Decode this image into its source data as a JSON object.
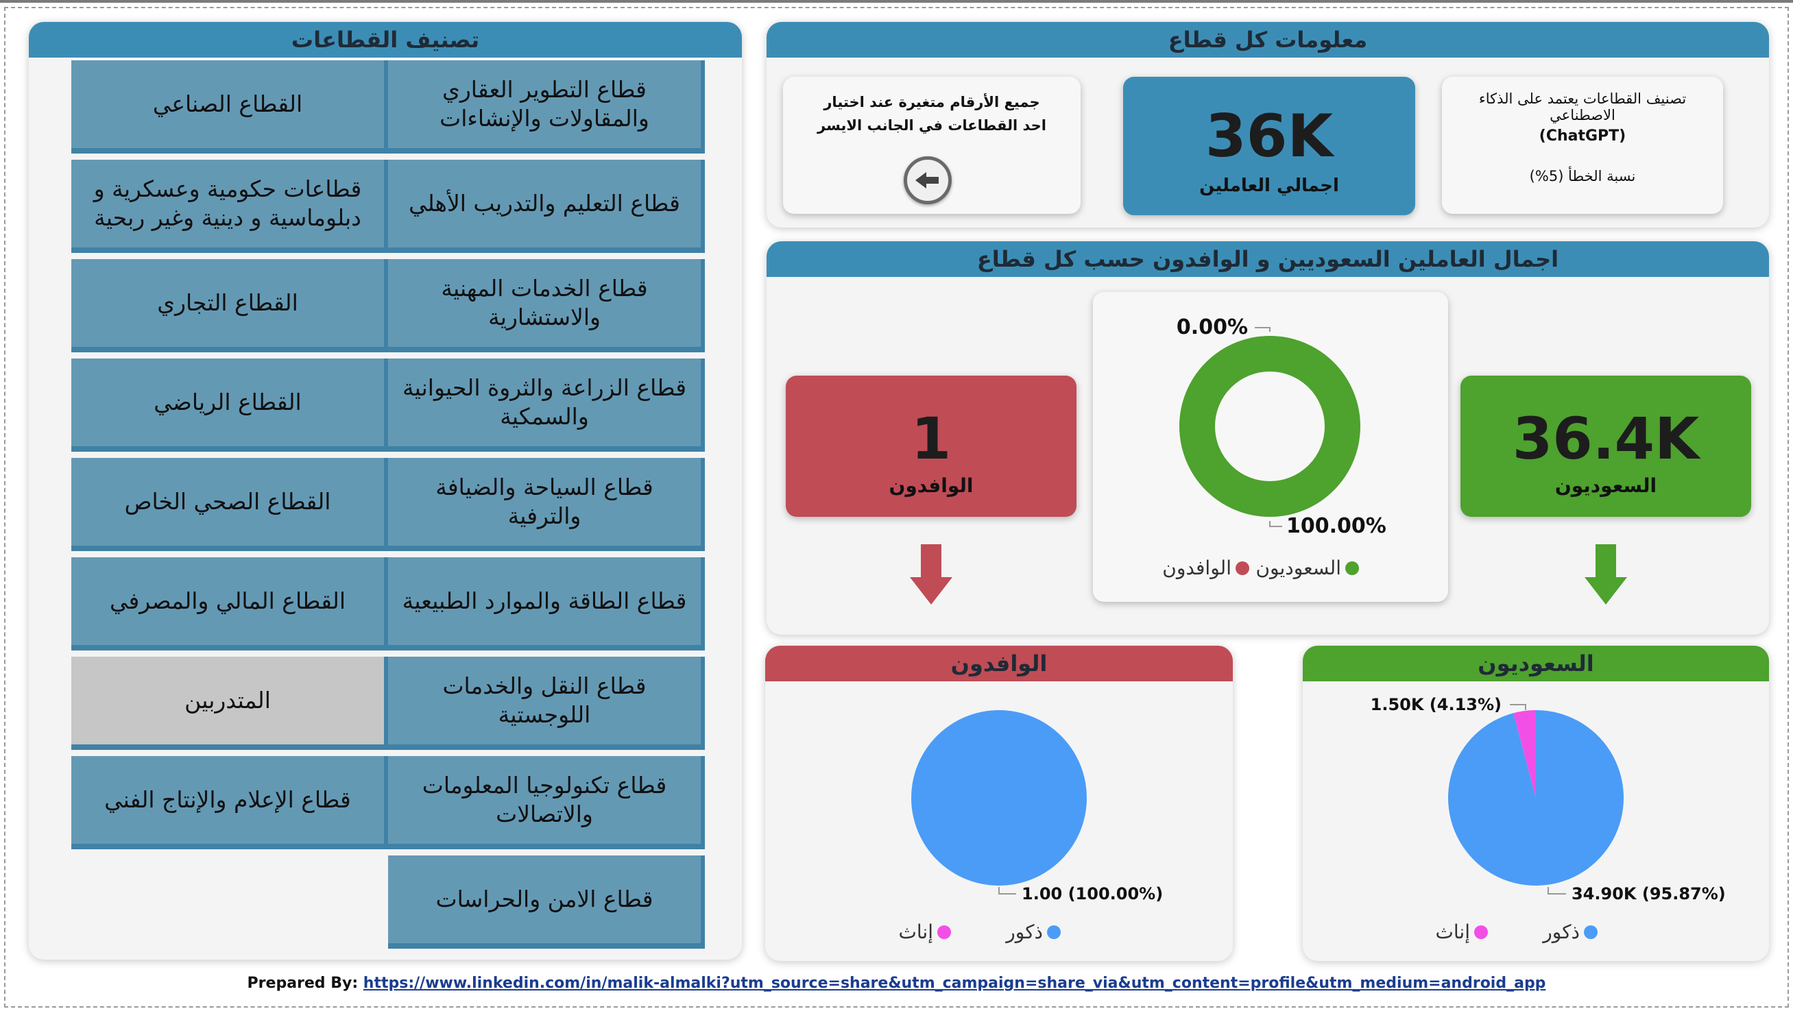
{
  "left_panel": {
    "title": "تصنيف القطاعات",
    "sectors": [
      {
        "label": "قطاع التطوير العقاري والمقاولات والإنشاءات",
        "selected": false
      },
      {
        "label": "القطاع الصناعي",
        "selected": false
      },
      {
        "label": "قطاع التعليم والتدريب الأهلي",
        "selected": false
      },
      {
        "label": "قطاعات حكومية وعسكرية و دبلوماسية و دينية وغير ربحية",
        "selected": false
      },
      {
        "label": "قطاع الخدمات المهنية والاستشارية",
        "selected": false
      },
      {
        "label": "القطاع التجاري",
        "selected": false
      },
      {
        "label": "قطاع الزراعة والثروة الحيوانية والسمكية",
        "selected": false
      },
      {
        "label": "القطاع الرياضي",
        "selected": false
      },
      {
        "label": "قطاع السياحة والضيافة والترفية",
        "selected": false
      },
      {
        "label": "القطاع الصحي الخاص",
        "selected": false
      },
      {
        "label": "قطاع الطاقة والموارد الطبيعية",
        "selected": false
      },
      {
        "label": "القطاع المالي والمصرفي",
        "selected": false
      },
      {
        "label": "قطاع النقل والخدمات اللوجستية",
        "selected": false
      },
      {
        "label": "المتدربين",
        "selected": true
      },
      {
        "label": "قطاع تكنولوجيا المعلومات والاتصالات",
        "selected": false
      },
      {
        "label": "قطاع الإعلام والإنتاج الفني",
        "selected": false
      },
      {
        "label": "قطاع الامن والحراسات",
        "selected": false
      }
    ]
  },
  "info_panel": {
    "title": "معلومات كل قطاع",
    "ai_note_line1": "تصنيف القطاعات يعتمد على الذكاء الاصطناعي",
    "ai_note_line2": "(ChatGPT)",
    "ai_note_error": "نسبة الخطأ (5%)",
    "total_value": "36K",
    "total_label": "اجمالي العاملين",
    "hint_text": "جميع الأرقام متغيرة عند اختيار احد القطاعات في الجانب الايسر",
    "arrow_icon": "arrow-left-icon"
  },
  "split_panel": {
    "title": "اجمال العاملين السعوديين و الوافدون حسب كل قطاع",
    "saudi_value": "36.4K",
    "saudi_label": "السعوديون",
    "expat_value": "1",
    "expat_label": "الوافدون",
    "colors": {
      "saudi": "#4ea22e",
      "expat": "#c04c56"
    }
  },
  "expat_gender_panel": {
    "title": "الوافدون"
  },
  "saudi_gender_panel": {
    "title": "السعوديون"
  },
  "chart_data": [
    {
      "type": "pie",
      "variant": "donut",
      "categories": [
        "السعوديون",
        "الوافدون"
      ],
      "values": [
        100.0,
        0.0
      ],
      "colors": [
        "#4ea22e",
        "#c04c56"
      ],
      "data_labels": [
        "100.00%",
        "0.00%"
      ],
      "legend": [
        "السعوديون",
        "الوافدون"
      ]
    },
    {
      "type": "pie",
      "categories": [
        "ذكور",
        "إناث"
      ],
      "values": [
        1.0,
        0.0
      ],
      "colors": [
        "#4b9cf6",
        "#f24fe6"
      ],
      "data_labels": [
        "1.00 (100.00%)"
      ],
      "legend": [
        "ذكور",
        "إناث"
      ]
    },
    {
      "type": "pie",
      "categories": [
        "ذكور",
        "إناث"
      ],
      "values": [
        34900,
        1500
      ],
      "colors": [
        "#4b9cf6",
        "#f24fe6"
      ],
      "data_labels": [
        "34.90K (95.87%)",
        "1.50K (4.13%)"
      ],
      "legend": [
        "ذكور",
        "إناث"
      ]
    }
  ],
  "footer": {
    "prefix": "Prepared By:",
    "link": "https://www.linkedin.com/in/malik-almalki?utm_source=share&utm_campaign=share_via&utm_content=profile&utm_medium=android_app"
  }
}
